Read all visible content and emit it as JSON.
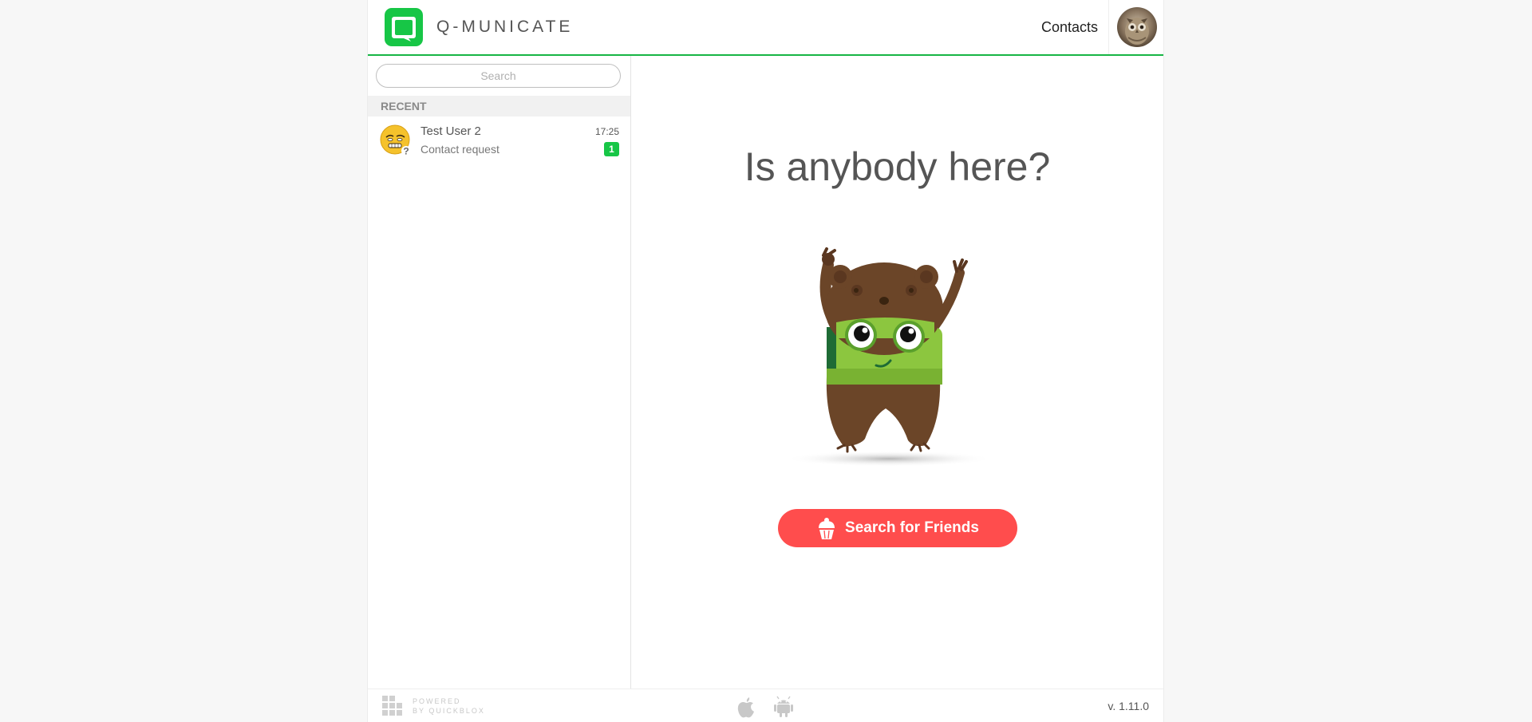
{
  "header": {
    "brand": "Q-MUNICATE",
    "contacts_label": "Contacts"
  },
  "sidebar": {
    "search_placeholder": "Search",
    "recent_label": "RECENT",
    "dialogs": [
      {
        "name": "Test User 2",
        "time": "17:25",
        "message": "Contact request",
        "unread": "1"
      }
    ]
  },
  "main": {
    "title": "Is anybody here?",
    "button_label": "Search for Friends"
  },
  "footer": {
    "powered_line1": "POWERED",
    "powered_line2": "BY QUICKBLOX",
    "version": "v. 1.11.0"
  },
  "colors": {
    "brand_green": "#17b544",
    "badge_green": "#17c646",
    "cta_red": "#ff4d4d"
  },
  "icons": {
    "logo": "qmunicate-logo-icon",
    "cta": "cupcake-icon",
    "footer": [
      "quickblox-logo-icon",
      "apple-icon",
      "android-icon"
    ]
  }
}
